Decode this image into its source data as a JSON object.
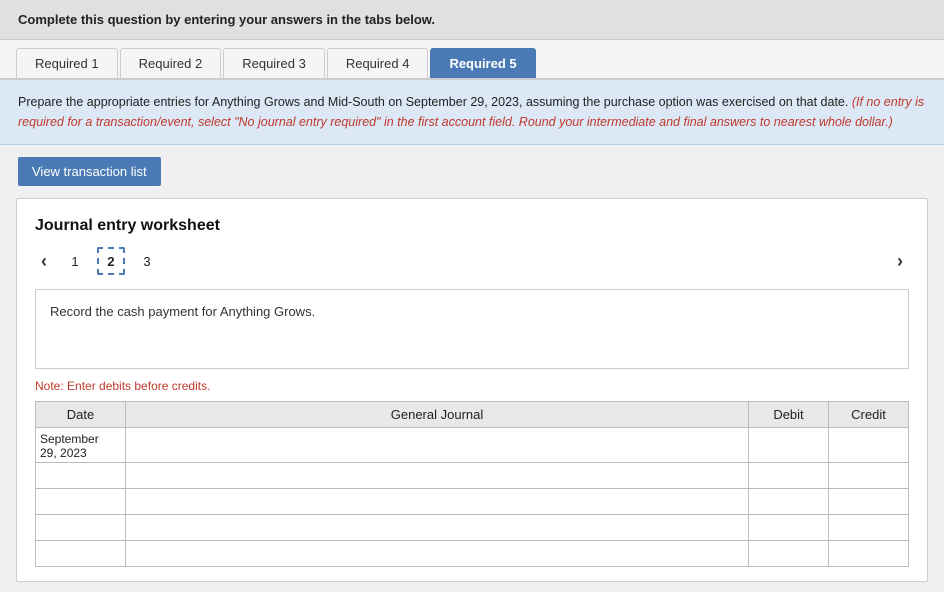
{
  "instruction_bar": {
    "text": "Complete this question by entering your answers in the tabs below."
  },
  "tabs": [
    {
      "id": "tab-required-1",
      "label": "Required 1",
      "active": false
    },
    {
      "id": "tab-required-2",
      "label": "Required 2",
      "active": false
    },
    {
      "id": "tab-required-3",
      "label": "Required 3",
      "active": false
    },
    {
      "id": "tab-required-4",
      "label": "Required 4",
      "active": false
    },
    {
      "id": "tab-required-5",
      "label": "Required 5",
      "active": true
    }
  ],
  "description": {
    "normal": "Prepare the appropriate entries for Anything Grows and Mid-South on September 29, 2023, assuming the purchase option was exercised on that date.",
    "italic": "(If no entry is required for a transaction/event, select \"No journal entry required\" in the first account field. Round your intermediate and final answers to nearest whole dollar.)"
  },
  "btn_view_label": "View transaction list",
  "worksheet": {
    "title": "Journal entry worksheet",
    "pages": [
      {
        "num": "1"
      },
      {
        "num": "2",
        "active": true
      },
      {
        "num": "3"
      }
    ],
    "record_note": "Record the cash payment for Anything Grows.",
    "note_text": "Note: Enter debits before credits.",
    "table": {
      "headers": [
        "Date",
        "General Journal",
        "Debit",
        "Credit"
      ],
      "rows": [
        {
          "date": "September\n29, 2023",
          "journal": "",
          "debit": "",
          "credit": ""
        },
        {
          "date": "",
          "journal": "",
          "debit": "",
          "credit": ""
        },
        {
          "date": "",
          "journal": "",
          "debit": "",
          "credit": ""
        },
        {
          "date": "",
          "journal": "",
          "debit": "",
          "credit": ""
        },
        {
          "date": "",
          "journal": "",
          "debit": "",
          "credit": ""
        }
      ]
    }
  },
  "colors": {
    "accent_blue": "#4a7ab5",
    "light_blue_bg": "#dce8f5",
    "red_italic": "#c0392b"
  }
}
